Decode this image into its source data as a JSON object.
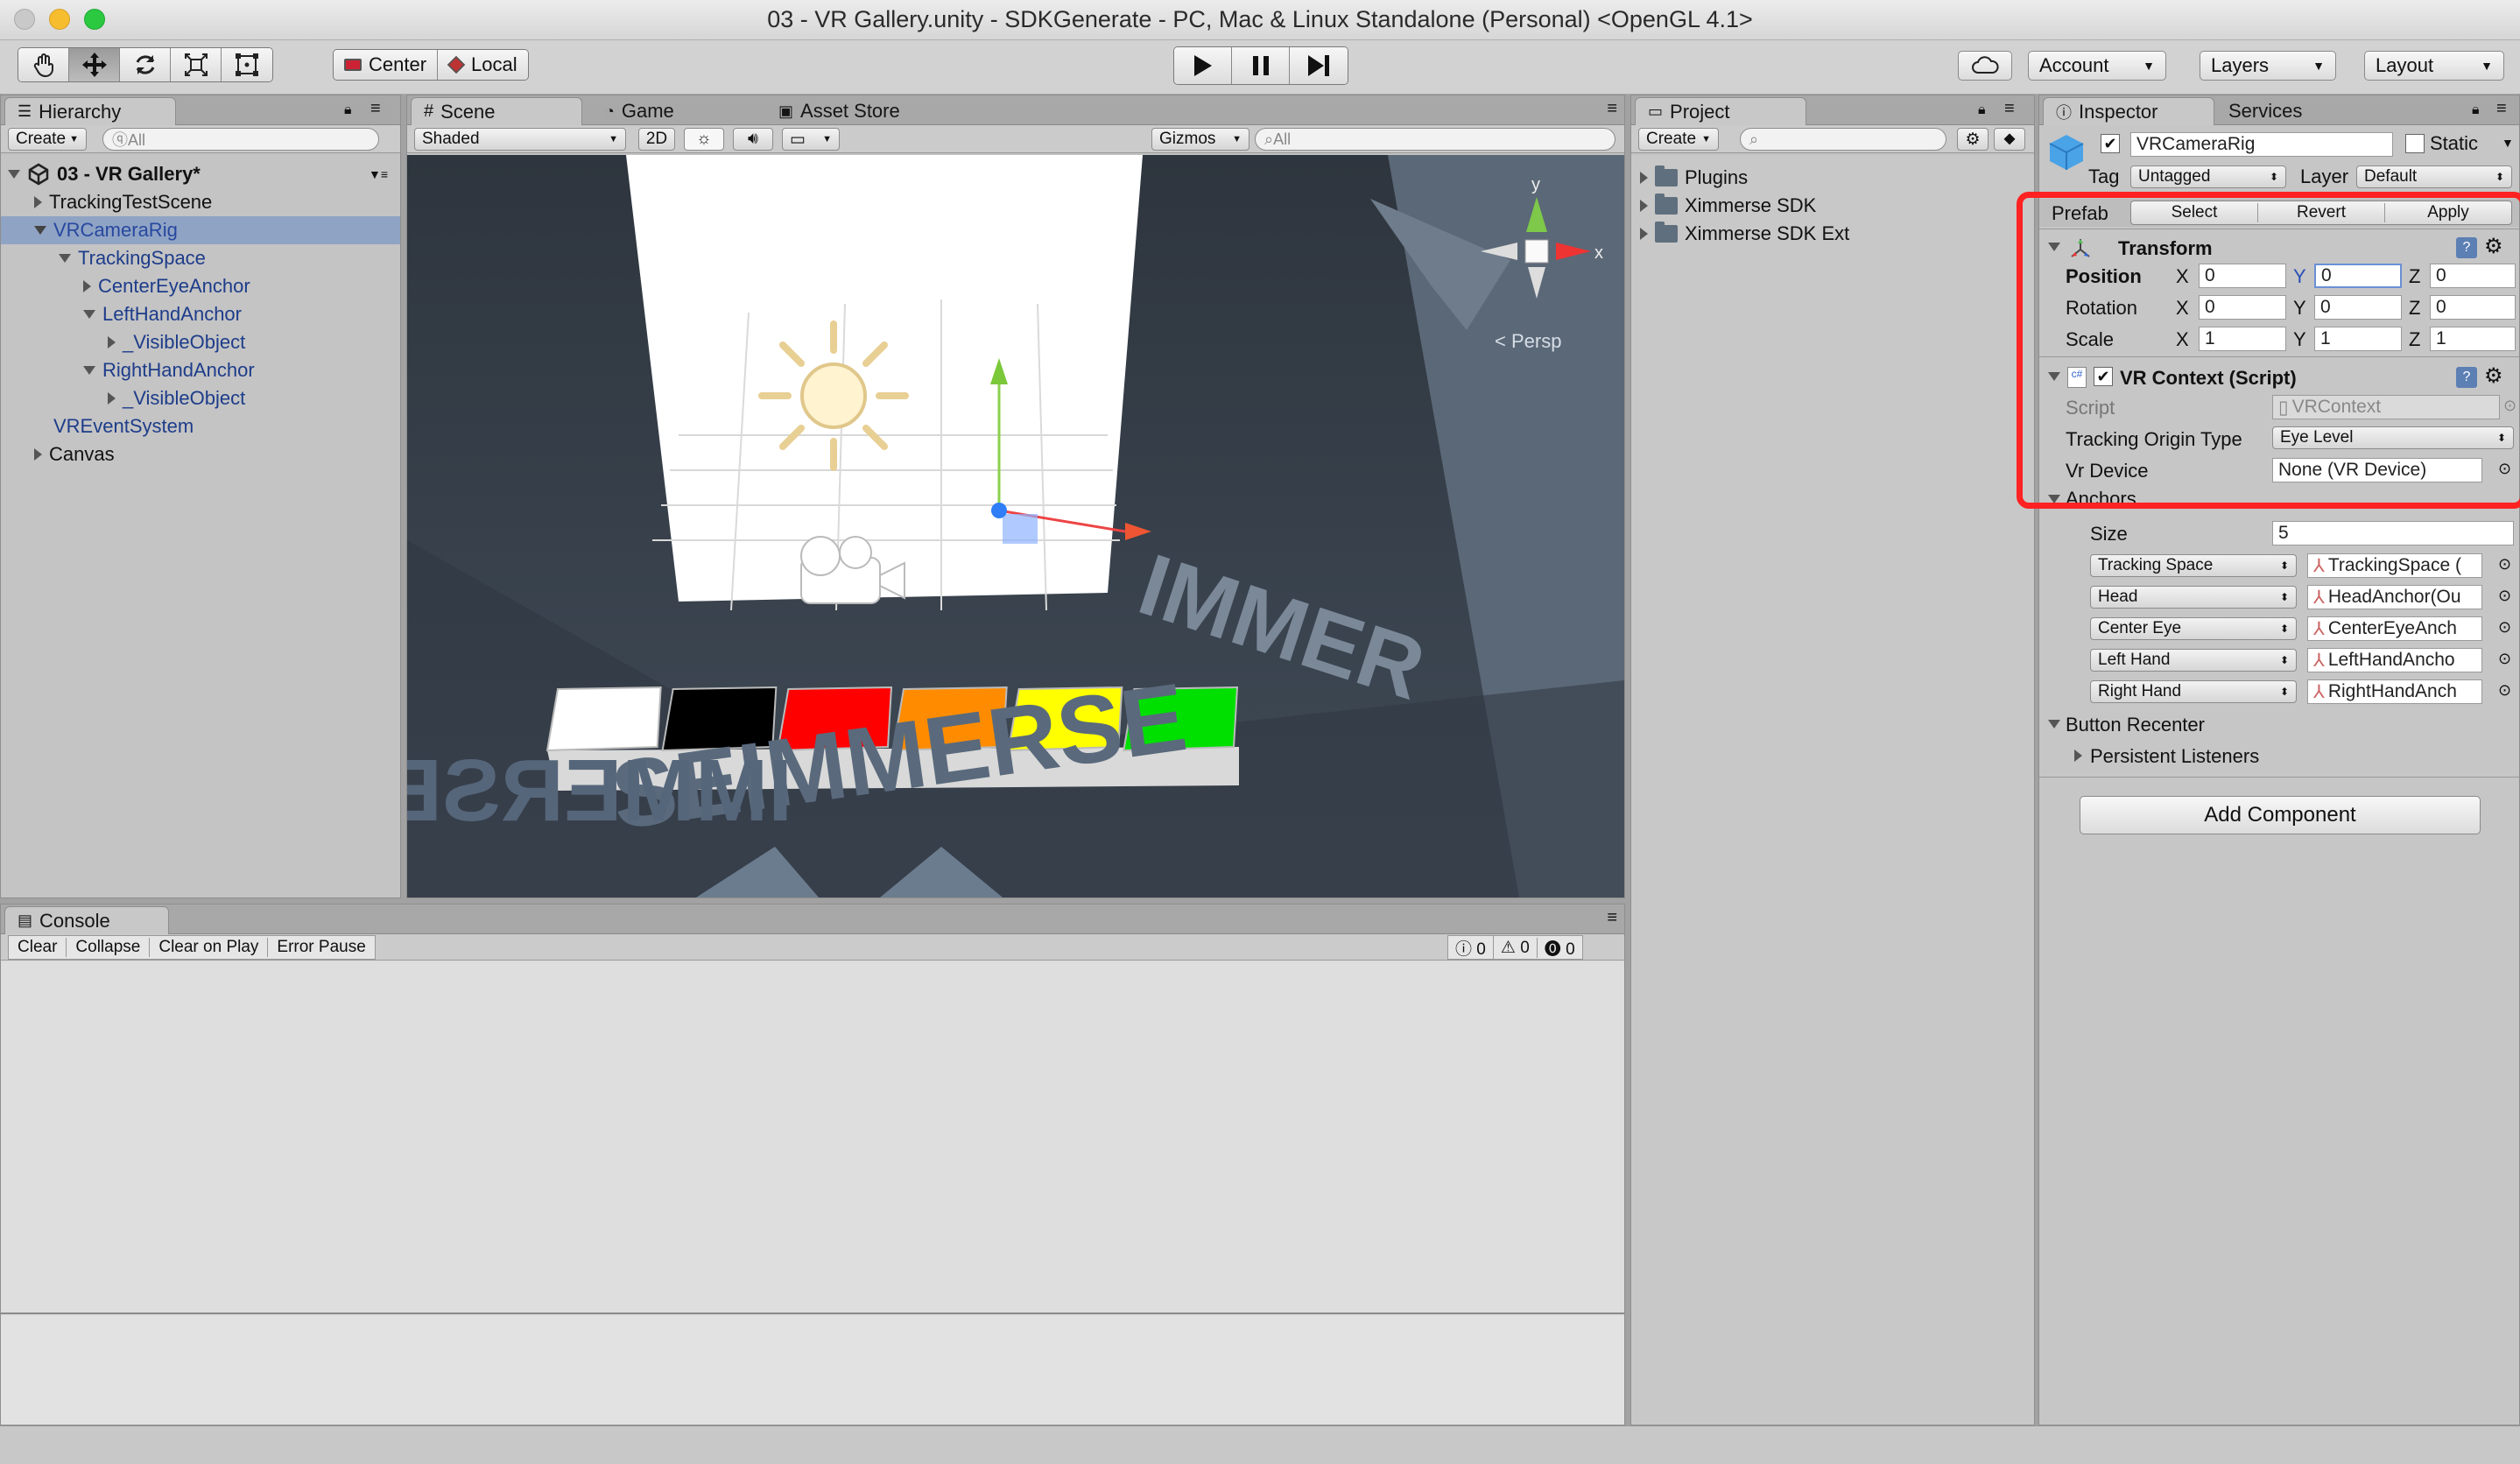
{
  "window": {
    "title": "03 - VR Gallery.unity - SDKGenerate - PC, Mac & Linux Standalone (Personal) <OpenGL 4.1>"
  },
  "toolbar": {
    "pivot_center": "Center",
    "pivot_local": "Local",
    "account": "Account",
    "layers": "Layers",
    "layout": "Layout"
  },
  "hierarchy": {
    "tab": "Hierarchy",
    "create": "Create",
    "search_placeholder": "ⓠAll",
    "scene": "03 - VR Gallery*",
    "items": [
      {
        "label": "TrackingTestScene"
      },
      {
        "label": "VRCameraRig"
      },
      {
        "label": "TrackingSpace"
      },
      {
        "label": "CenterEyeAnchor"
      },
      {
        "label": "LeftHandAnchor"
      },
      {
        "label": "_VisibleObject"
      },
      {
        "label": "RightHandAnchor"
      },
      {
        "label": "_VisibleObject"
      },
      {
        "label": "VREventSystem"
      },
      {
        "label": "Canvas"
      }
    ]
  },
  "scene_view": {
    "tabs": [
      "Scene",
      "Game",
      "Asset Store"
    ],
    "shading": "Shaded",
    "mode_2d": "2D",
    "gizmos": "Gizmos",
    "search_placeholder": "All",
    "persp_label": "< Persp",
    "axis_x": "x",
    "axis_y": "y",
    "floor_text": "IMMERSE",
    "wall_text_left": "SEIMMERSE",
    "wall_text_right": "IMMER",
    "swatches": [
      "#ffffff",
      "#000000",
      "#ff0000",
      "#ff8c00",
      "#ffff00",
      "#00e000"
    ]
  },
  "console": {
    "tab": "Console",
    "buttons": [
      "Clear",
      "Collapse",
      "Clear on Play",
      "Error Pause"
    ],
    "counts": {
      "info": "0",
      "warn": "0",
      "error": "0"
    }
  },
  "project": {
    "tab": "Project",
    "create": "Create",
    "folders": [
      "Plugins",
      "Ximmerse SDK",
      "Ximmerse SDK Ext"
    ]
  },
  "inspector": {
    "tab": "Inspector",
    "tab2": "Services",
    "object_name": "VRCameraRig",
    "static_label": "Static",
    "tag_label": "Tag",
    "tag_value": "Untagged",
    "layer_label": "Layer",
    "layer_value": "Default",
    "prefab": {
      "label": "Prefab",
      "select": "Select",
      "revert": "Revert",
      "apply": "Apply"
    },
    "transform": {
      "title": "Transform",
      "rows": [
        {
          "label": "Position",
          "x": "0",
          "y": "0",
          "z": "0"
        },
        {
          "label": "Rotation",
          "x": "0",
          "y": "0",
          "z": "0"
        },
        {
          "label": "Scale",
          "x": "1",
          "y": "1",
          "z": "1"
        }
      ],
      "axis_x": "X",
      "axis_y": "Y",
      "axis_z": "Z"
    },
    "vr_context": {
      "title": "VR Context (Script)",
      "script_label": "Script",
      "script_value": "VRContext",
      "origin_label": "Tracking Origin Type",
      "origin_value": "Eye Level",
      "device_label": "Vr Device",
      "device_value": "None (VR Device)",
      "anchors_label": "Anchors",
      "size_label": "Size",
      "size_value": "5",
      "anchors": [
        {
          "type": "Tracking Space",
          "ref": "TrackingSpace ("
        },
        {
          "type": "Head",
          "ref": "HeadAnchor(Ou"
        },
        {
          "type": "Center Eye",
          "ref": "CenterEyeAnch"
        },
        {
          "type": "Left Hand",
          "ref": "LeftHandAncho"
        },
        {
          "type": "Right Hand",
          "ref": "RightHandAnch"
        }
      ],
      "button_recenter": "Button Recenter",
      "persistent_listeners": "Persistent Listeners"
    },
    "add_component": "Add Component"
  },
  "colors": {
    "highlight": "#ff2222",
    "selection": "#8fa3c4",
    "accent_blue": "#1d3c8a"
  },
  "icons": [
    "hand-icon",
    "move-icon",
    "rotate-icon",
    "scale-icon",
    "rect-icon",
    "play-icon",
    "pause-icon",
    "step-icon",
    "cloud-icon",
    "sun-icon",
    "speaker-icon",
    "image-icon",
    "gear-icon",
    "book-icon",
    "lock-icon",
    "menu-icon"
  ]
}
